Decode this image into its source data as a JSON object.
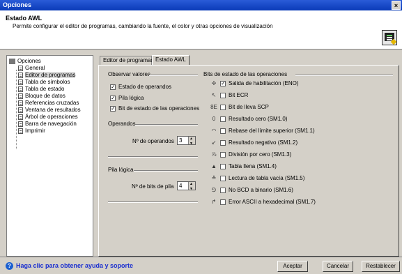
{
  "window": {
    "title": "Opciones",
    "close": "×"
  },
  "header": {
    "title": "Estado AWL",
    "description": "Permite configurar el editor de programas, cambiando la fuente, el color y otras opciones de visualización"
  },
  "tree": {
    "root": "Opciones",
    "items": [
      "General",
      "Editor de programas",
      "Tabla de símbolos",
      "Tabla de estado",
      "Bloque de datos",
      "Referencias cruzadas",
      "Ventana de resultados",
      "Árbol de operaciones",
      "Barra de navegación",
      "Imprimir"
    ],
    "selected": "Editor de programas"
  },
  "tabs": [
    "Editor de programas",
    "Estado AWL"
  ],
  "observar": {
    "title": "Observar valores",
    "items": [
      {
        "label": "Estado de operandos",
        "checked": true
      },
      {
        "label": "Pila lógica",
        "checked": true
      },
      {
        "label": "Bit de estado de las operaciones",
        "checked": true
      }
    ]
  },
  "operandos": {
    "title": "Operandos",
    "label": "Nº de operandos",
    "value": "3"
  },
  "pila": {
    "title": "Pila lógica",
    "label": "Nº de bits de pila",
    "value": "4"
  },
  "bits": {
    "title": "Bits de estado de las operaciones",
    "items": [
      {
        "icon": "✢",
        "label": "Salida de habilitación (ENO)",
        "checked": true
      },
      {
        "icon": "↖",
        "label": "Bit ECR",
        "checked": false
      },
      {
        "icon": "8E",
        "label": "Bit de lleva SCP",
        "checked": false
      },
      {
        "icon": "0",
        "label": "Resultado cero (SM1.0)",
        "checked": false
      },
      {
        "icon": "◠",
        "label": "Rebase del límite superior (SM1.1)",
        "checked": false
      },
      {
        "icon": "↙",
        "label": "Resultado negativo (SM1.2)",
        "checked": false
      },
      {
        "icon": "⅞",
        "label": "División por cero (SM1.3)",
        "checked": false
      },
      {
        "icon": "▲",
        "label": "Tabla llena (SM1.4)",
        "checked": false
      },
      {
        "icon": "≛",
        "label": "Lectura de tabla vacía (SM1.5)",
        "checked": false
      },
      {
        "icon": "⅁",
        "label": "No BCD a binario (SM1.6)",
        "checked": false
      },
      {
        "icon": "↱",
        "label": "Error ASCII a hexadecimal (SM1.7)",
        "checked": false
      }
    ]
  },
  "footer": {
    "help": "Haga clic para obtener ayuda y soporte",
    "buttons": [
      "Aceptar",
      "Cancelar",
      "Restablecer"
    ]
  }
}
